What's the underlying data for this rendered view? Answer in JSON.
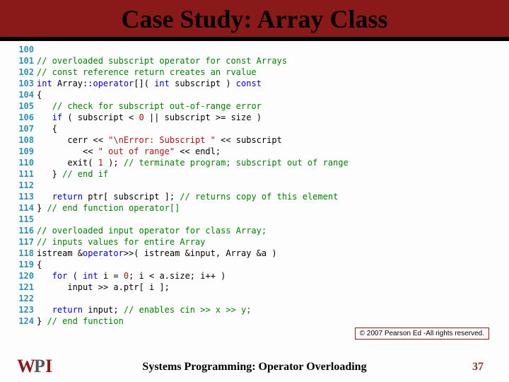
{
  "slide": {
    "title": "Case Study: Array Class",
    "footer": "Systems Programming:  Operator Overloading",
    "page": "37",
    "copyright": "© 2007 Pearson Ed -All rights reserved.",
    "logo_letters": {
      "w": "W",
      "p": "P",
      "i": "I"
    }
  },
  "code": {
    "lines": [
      {
        "n": "100",
        "segs": []
      },
      {
        "n": "101",
        "segs": [
          {
            "c": "cm",
            "t": "// overloaded subscript operator for const Arrays"
          }
        ]
      },
      {
        "n": "102",
        "segs": [
          {
            "c": "cm",
            "t": "// const reference return creates an rvalue"
          }
        ]
      },
      {
        "n": "103",
        "segs": [
          {
            "c": "tp",
            "t": "int "
          },
          {
            "c": "",
            "t": "Array::"
          },
          {
            "c": "kw",
            "t": "operator"
          },
          {
            "c": "",
            "t": "[]( "
          },
          {
            "c": "tp",
            "t": "int"
          },
          {
            "c": "",
            "t": " subscript ) "
          },
          {
            "c": "kw",
            "t": "const"
          }
        ]
      },
      {
        "n": "104",
        "segs": [
          {
            "c": "",
            "t": "{"
          }
        ]
      },
      {
        "n": "105",
        "segs": [
          {
            "c": "",
            "t": "   "
          },
          {
            "c": "cm",
            "t": "// check for subscript out-of-range error"
          }
        ]
      },
      {
        "n": "106",
        "segs": [
          {
            "c": "",
            "t": "   "
          },
          {
            "c": "kw",
            "t": "if"
          },
          {
            "c": "",
            "t": " ( subscript < "
          },
          {
            "c": "num",
            "t": "0"
          },
          {
            "c": "",
            "t": " || subscript >= size )"
          }
        ]
      },
      {
        "n": "107",
        "segs": [
          {
            "c": "",
            "t": "   {"
          }
        ]
      },
      {
        "n": "108",
        "segs": [
          {
            "c": "",
            "t": "      cerr << "
          },
          {
            "c": "str",
            "t": "\"\\nError: Subscript \""
          },
          {
            "c": "",
            "t": " << subscript"
          }
        ]
      },
      {
        "n": "109",
        "segs": [
          {
            "c": "",
            "t": "         << "
          },
          {
            "c": "str",
            "t": "\" out of range\""
          },
          {
            "c": "",
            "t": " << endl;"
          }
        ]
      },
      {
        "n": "110",
        "segs": [
          {
            "c": "",
            "t": "      exit( "
          },
          {
            "c": "num",
            "t": "1"
          },
          {
            "c": "",
            "t": " ); "
          },
          {
            "c": "cm",
            "t": "// terminate program; subscript out of range"
          }
        ]
      },
      {
        "n": "111",
        "segs": [
          {
            "c": "",
            "t": "   } "
          },
          {
            "c": "cm",
            "t": "// end if"
          }
        ]
      },
      {
        "n": "112",
        "segs": []
      },
      {
        "n": "113",
        "segs": [
          {
            "c": "",
            "t": "   "
          },
          {
            "c": "kw",
            "t": "return"
          },
          {
            "c": "",
            "t": " ptr[ subscript ]; "
          },
          {
            "c": "cm",
            "t": "// returns copy of this element"
          }
        ]
      },
      {
        "n": "114",
        "segs": [
          {
            "c": "",
            "t": "} "
          },
          {
            "c": "cm",
            "t": "// end function operator[]"
          }
        ]
      },
      {
        "n": "115",
        "segs": []
      },
      {
        "n": "116",
        "segs": [
          {
            "c": "cm",
            "t": "// overloaded input operator for class Array;"
          }
        ]
      },
      {
        "n": "117",
        "segs": [
          {
            "c": "cm",
            "t": "// inputs values for entire Array"
          }
        ]
      },
      {
        "n": "118",
        "segs": [
          {
            "c": "",
            "t": "istream &"
          },
          {
            "c": "kw",
            "t": "operator"
          },
          {
            "c": "",
            "t": ">>( istream &input, Array &a )"
          }
        ]
      },
      {
        "n": "119",
        "segs": [
          {
            "c": "",
            "t": "{"
          }
        ]
      },
      {
        "n": "120",
        "segs": [
          {
            "c": "",
            "t": "   "
          },
          {
            "c": "kw",
            "t": "for"
          },
          {
            "c": "",
            "t": " ( "
          },
          {
            "c": "tp",
            "t": "int"
          },
          {
            "c": "",
            "t": " i = "
          },
          {
            "c": "num",
            "t": "0"
          },
          {
            "c": "",
            "t": "; i < a.size; i++ )"
          }
        ]
      },
      {
        "n": "121",
        "segs": [
          {
            "c": "",
            "t": "      input >> a.ptr[ i ];"
          }
        ]
      },
      {
        "n": "122",
        "segs": []
      },
      {
        "n": "123",
        "segs": [
          {
            "c": "",
            "t": "   "
          },
          {
            "c": "kw",
            "t": "return"
          },
          {
            "c": "",
            "t": " input; "
          },
          {
            "c": "cm",
            "t": "// enables cin >> x >> y;"
          }
        ]
      },
      {
        "n": "124",
        "segs": [
          {
            "c": "",
            "t": "} "
          },
          {
            "c": "cm",
            "t": "// end function"
          }
        ]
      }
    ]
  }
}
